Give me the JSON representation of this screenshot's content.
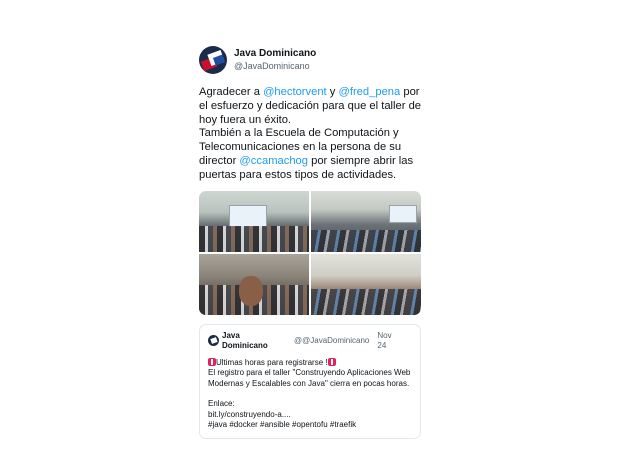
{
  "author": {
    "display_name": "Java Dominicano",
    "handle": "@JavaDominicano"
  },
  "tweet": {
    "t1": "Agradecer a ",
    "m1": "@hectorvent",
    "t2": " y ",
    "m2": "@fred_pena",
    "t3": " por el esfuerzo y dedicación para que el taller de hoy fuera un éxito.",
    "t4": "También a la Escuela de Computación y Telecomunicaciones en la persona de su director ",
    "m3": "@ccamachog",
    "t5": " por siempre abrir las puertas para estos tipos de actividades."
  },
  "quoted_tweet": {
    "display_name": "Java Dominicano",
    "handle": "@@JavaDominicano",
    "date": "Nov 24",
    "line1": "Ultimas horas para registrarse !",
    "line2": "El registro para el taller \"Construyendo Aplicaciones Web Modernas y Escalables con Java\" cierra en pocas horas.",
    "line3": "Enlace:",
    "line4": "bit.ly/construyendo-a....",
    "line5": "#java #docker #ansible #opentofu #traefik"
  },
  "colors": {
    "mention": "#1d9bf0",
    "secondary_text": "#536471",
    "border": "#e1e8ed"
  },
  "icons": {
    "avatar": "java-dominicano-logo",
    "emoji": "rotating-light-emoji"
  }
}
